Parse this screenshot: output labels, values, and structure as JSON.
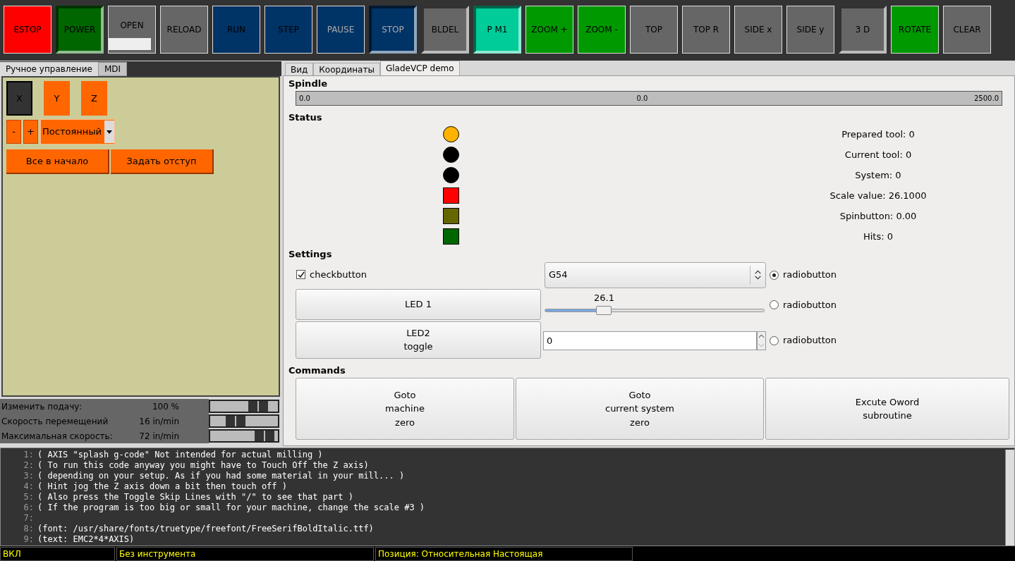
{
  "toolbar": [
    {
      "label": "ESTOP",
      "color": "#ff0000",
      "kind": "plain",
      "dim": false
    },
    {
      "label": "POWER",
      "color": "#006600",
      "kind": "pressed",
      "dim": false
    },
    {
      "label": "OPEN",
      "color": "#666666",
      "kind": "file",
      "dim": false
    },
    {
      "label": "RELOAD",
      "color": "#666666",
      "kind": "plain",
      "dim": false
    },
    {
      "label": "RUN",
      "color": "#003366",
      "kind": "plain",
      "dim": false
    },
    {
      "label": "STEP",
      "color": "#003366",
      "kind": "plain",
      "dim": false
    },
    {
      "label": "PAUSE",
      "color": "#003366",
      "kind": "plain",
      "dim": true
    },
    {
      "label": "STOP",
      "color": "#003366",
      "kind": "pressed",
      "dim": true
    },
    {
      "label": "BLDEL",
      "color": "#666666",
      "kind": "pressed",
      "dim": false
    },
    {
      "label": "P M1",
      "color": "#00cc99",
      "kind": "pressed",
      "dim": false
    },
    {
      "label": "ZOOM +",
      "color": "#009900",
      "kind": "plain",
      "dim": false
    },
    {
      "label": "ZOOM -",
      "color": "#009900",
      "kind": "plain",
      "dim": false
    },
    {
      "label": "TOP",
      "color": "#666666",
      "kind": "plain",
      "dim": false
    },
    {
      "label": "TOP R",
      "color": "#666666",
      "kind": "plain",
      "dim": false
    },
    {
      "label": "SIDE x",
      "color": "#666666",
      "kind": "plain",
      "dim": false
    },
    {
      "label": "SIDE y",
      "color": "#666666",
      "kind": "plain",
      "dim": false
    },
    {
      "label": "3 D",
      "color": "#666666",
      "kind": "pressed",
      "dim": false
    },
    {
      "label": "ROTATE",
      "color": "#009900",
      "kind": "plain",
      "dim": false
    },
    {
      "label": "CLEAR",
      "color": "#666666",
      "kind": "plain",
      "dim": false
    }
  ],
  "left_panel": {
    "tabs": [
      {
        "label": "Ручное управление",
        "selected": true
      },
      {
        "label": "MDI",
        "selected": false
      }
    ],
    "axes": [
      {
        "label": "X",
        "selected": true
      },
      {
        "label": "Y",
        "selected": false
      },
      {
        "label": "Z",
        "selected": false
      }
    ],
    "jog_minus": "-",
    "jog_plus": "+",
    "jog_mode": "Постоянный",
    "actions": [
      "Все в начало",
      "Задать отступ"
    ],
    "overrides": [
      {
        "label": "Изменить подачу:",
        "reading": "100 %",
        "level": 0.8
      },
      {
        "label": "Скорость перемещений",
        "reading": "16 in/min",
        "level": 0.32
      },
      {
        "label": "Максимальная скорость:",
        "reading": "72 in/min",
        "level": 0.93
      }
    ]
  },
  "right_panel": {
    "tabs": [
      {
        "label": "Вид",
        "selected": false
      },
      {
        "label": "Координаты",
        "selected": false
      },
      {
        "label": "GladeVCP demo",
        "selected": true
      }
    ],
    "spindle": {
      "title": "Spindle",
      "min": "0.0",
      "value": "0.0",
      "max": "2500.0",
      "level": 0
    },
    "status": {
      "title": "Status",
      "leds": [
        {
          "kind": "circle",
          "color": "#ffb300"
        },
        {
          "kind": "circle",
          "color": "#000000"
        },
        {
          "kind": "circle",
          "color": "#000000"
        },
        {
          "kind": "square",
          "color": "#ff0000"
        },
        {
          "kind": "square",
          "color": "#666600"
        },
        {
          "kind": "square",
          "color": "#006600"
        }
      ],
      "readouts": [
        "Prepared tool: 0",
        "Current tool: 0",
        "System: 0",
        "Scale value: 26.1000",
        "Spinbutton: 0.00",
        "Hits: 0"
      ]
    },
    "settings": {
      "title": "Settings",
      "checkbutton": {
        "label": "checkbutton",
        "checked": true
      },
      "combo": "G54",
      "led1": "LED 1",
      "led2": [
        "LED2",
        "toggle"
      ],
      "scale": {
        "reading": "26.1",
        "level": 0.27
      },
      "spin": "0",
      "radios": [
        {
          "label": "radiobutton",
          "selected": true
        },
        {
          "label": "radiobutton",
          "selected": false
        },
        {
          "label": "radiobutton",
          "selected": false
        }
      ]
    },
    "commands": {
      "title": "Commands",
      "buttons": [
        [
          "Goto",
          "machine",
          "zero"
        ],
        [
          "Goto",
          "current system",
          "zero"
        ],
        [
          "Excute Oword",
          "subroutine"
        ]
      ]
    }
  },
  "gcode": [
    {
      "n": "1:",
      "text": "( AXIS \"splash g-code\" Not intended for actual milling )"
    },
    {
      "n": "2:",
      "text": "( To run this code anyway you might have to Touch Off the Z axis)"
    },
    {
      "n": "3:",
      "text": "( depending on your setup. As if you had some material in your mill... )"
    },
    {
      "n": "4:",
      "text": "( Hint jog the Z axis down a bit then touch off )"
    },
    {
      "n": "5:",
      "text": "( Also press the Toggle Skip Lines with \"/\" to see that part )"
    },
    {
      "n": "6:",
      "text": "( If the program is too big or small for your machine, change the scale #3 )"
    },
    {
      "n": "7:"
    },
    {
      "n": "8:",
      "text": "(font: /usr/share/fonts/truetype/freefont/FreeSerifBoldItalic.ttf)"
    },
    {
      "n": "9:",
      "text": "(text: EMC2*4*AXIS)"
    }
  ],
  "status_bar": [
    "ВКЛ",
    "Без инструмента",
    "Позиция: Относительная Настоящая"
  ]
}
